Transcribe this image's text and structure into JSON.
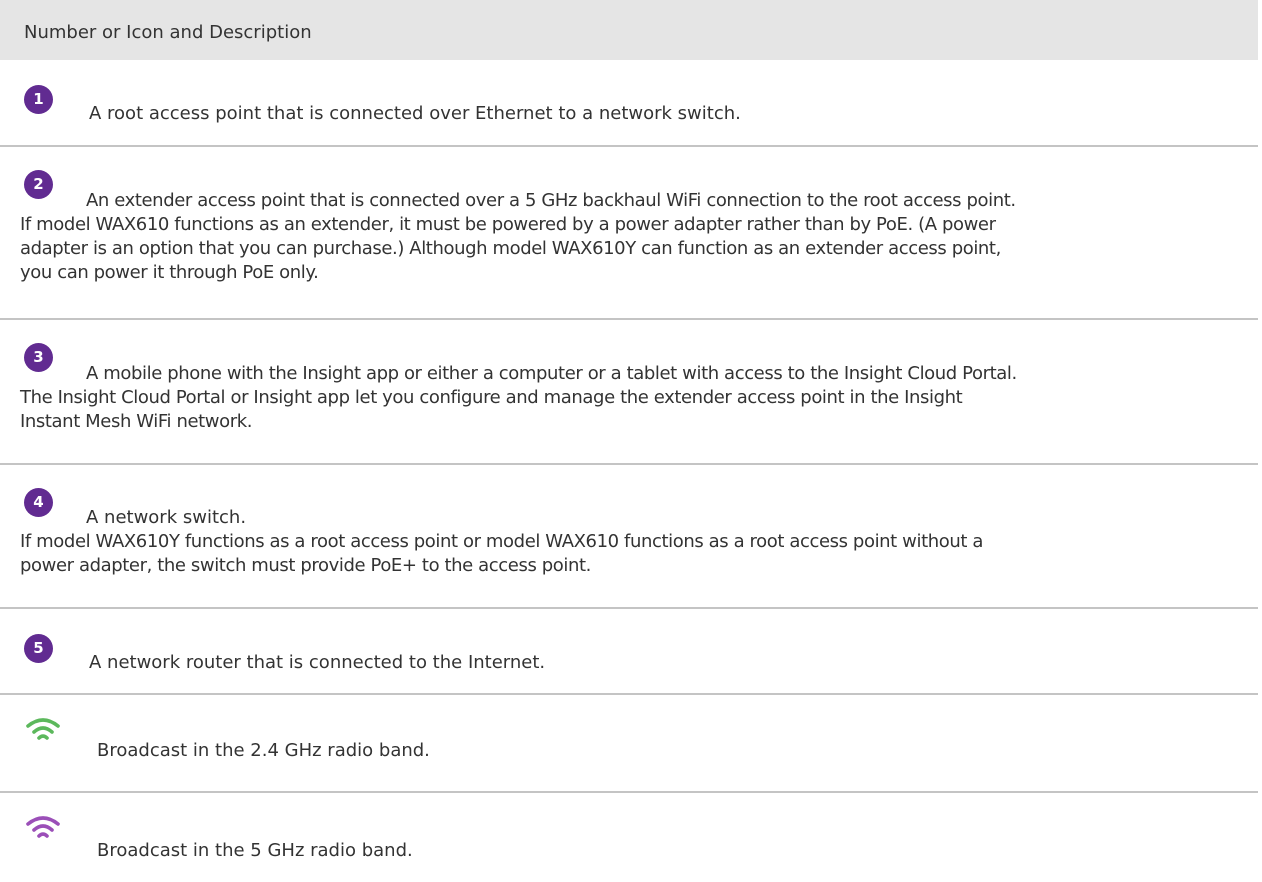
{
  "header": {
    "title": "Number or Icon and Description"
  },
  "rows": [
    {
      "marker": "1",
      "lines": [
        "A root access point that is connected over Ethernet to a network switch."
      ]
    },
    {
      "marker": "2",
      "lines": [
        "An extender access point that is connected over a 5 GHz backhaul WiFi connection to the root access point.",
        "If model WAX610 functions as an extender, it must be powered by a power adapter rather than by PoE. (A power",
        "adapter is an option that you can purchase.) Although model WAX610Y can function as an extender access point,",
        "you can power it through PoE only."
      ]
    },
    {
      "marker": "3",
      "lines": [
        "A mobile phone with the Insight app or either a computer or a tablet with access to the Insight Cloud Portal.",
        "The Insight Cloud Portal or Insight app let you configure and manage the extender access point in the Insight",
        "Instant Mesh WiFi network."
      ]
    },
    {
      "marker": "4",
      "lines": [
        "A network switch.",
        "If model WAX610Y functions as a root access point or model WAX610 functions as a root access point without a",
        "power adapter, the switch must provide PoE+ to the access point."
      ]
    },
    {
      "marker": "5",
      "lines": [
        "A network router that is connected to the Internet."
      ]
    },
    {
      "icon": "wifi-icon",
      "icon_color": "#5cb85c",
      "lines": [
        "Broadcast in the 2.4 GHz radio band."
      ]
    },
    {
      "icon": "wifi-icon",
      "icon_color": "#9b4fb8",
      "lines": [
        "Broadcast in the 5 GHz radio band."
      ]
    }
  ],
  "colors": {
    "badge": "#612b91",
    "header_bg": "#e5e5e5",
    "divider": "#c4c4c4",
    "text": "#333333"
  }
}
